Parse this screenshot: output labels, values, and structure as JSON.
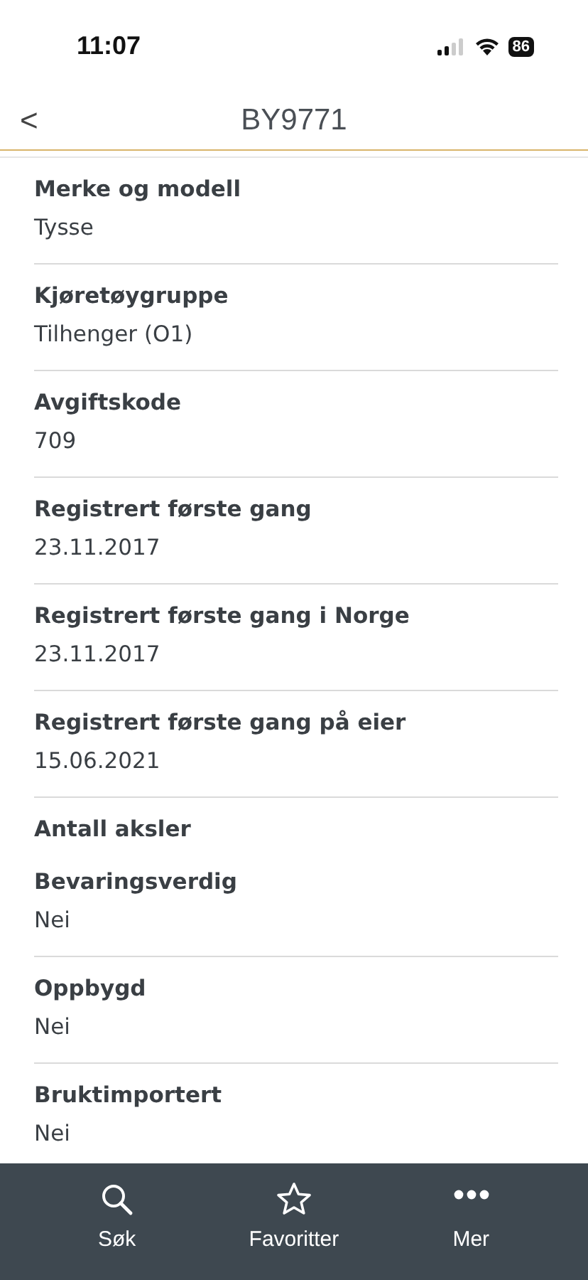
{
  "status_bar": {
    "time": "11:07",
    "battery": "86"
  },
  "header": {
    "back": "<",
    "title": "BY9771"
  },
  "fields": [
    {
      "label": "Merke og modell",
      "value": "Tysse"
    },
    {
      "label": "Kjøretøygruppe",
      "value": "Tilhenger (O1)"
    },
    {
      "label": "Avgiftskode",
      "value": "709"
    },
    {
      "label": "Registrert første gang",
      "value": "23.11.2017"
    },
    {
      "label": "Registrert første gang i Norge",
      "value": "23.11.2017"
    },
    {
      "label": "Registrert første gang på eier",
      "value": "15.06.2021"
    },
    {
      "label": "Antall aksler"
    },
    {
      "label": "Bevaringsverdig",
      "value": "Nei"
    },
    {
      "label": "Oppbygd",
      "value": "Nei"
    },
    {
      "label": "Bruktimportert",
      "value": "Nei"
    }
  ],
  "tab_bar": [
    {
      "kind": "search",
      "label": "Søk"
    },
    {
      "kind": "star",
      "label": "Favoritter"
    },
    {
      "kind": "more",
      "label": "Mer"
    }
  ]
}
